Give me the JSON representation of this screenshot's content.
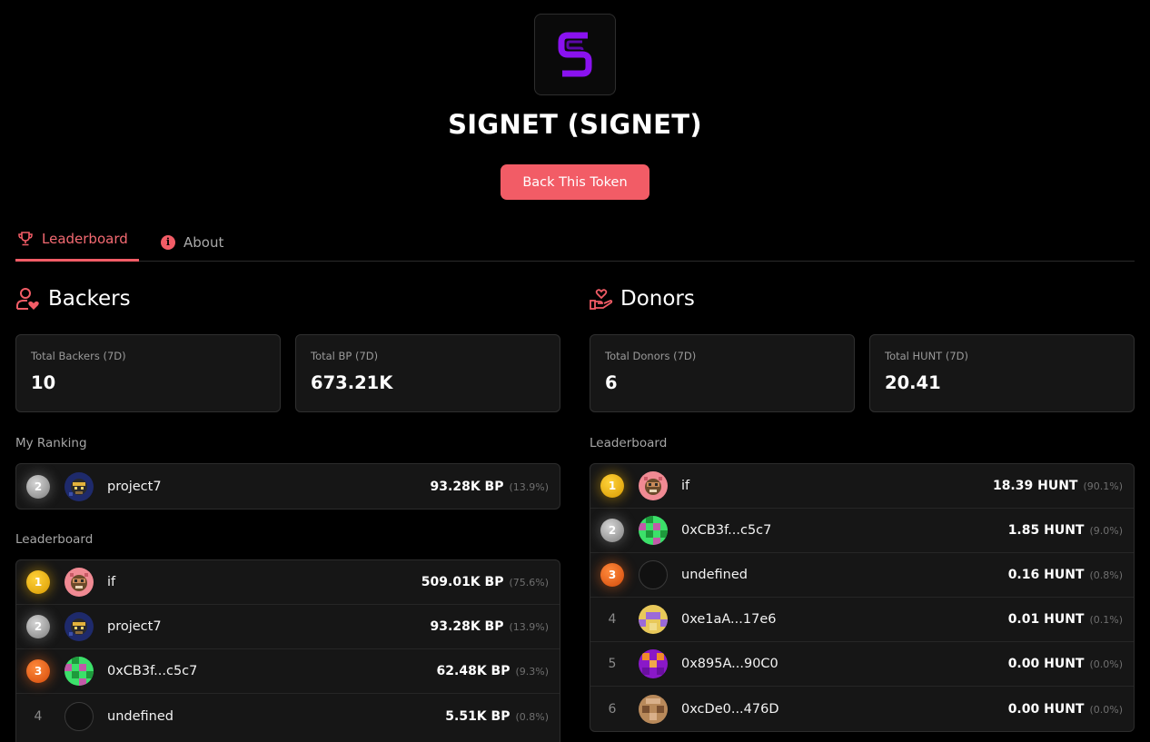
{
  "token": {
    "title": "SIGNET (SIGNET)",
    "back_label": "Back This Token"
  },
  "tabs": [
    {
      "label": "Leaderboard",
      "icon": "trophy-icon",
      "active": true
    },
    {
      "label": "About",
      "icon": "info-icon",
      "active": false
    }
  ],
  "colors": {
    "accent": "#f25c66",
    "logo": "#8a12f0"
  },
  "backers": {
    "heading": "Backers",
    "stats": [
      {
        "label": "Total Backers (7D)",
        "value": "10"
      },
      {
        "label": "Total BP (7D)",
        "value": "673.21K"
      }
    ],
    "my_ranking_label": "My Ranking",
    "my_ranking": {
      "rank": "2",
      "medal": "silver",
      "name": "project7",
      "value": "93.28K BP",
      "pct": "(13.9%)",
      "avatar": "project7"
    },
    "leaderboard_label": "Leaderboard",
    "rows": [
      {
        "rank": "1",
        "medal": "gold",
        "name": "if",
        "value": "509.01K BP",
        "pct": "(75.6%)",
        "avatar": "if"
      },
      {
        "rank": "2",
        "medal": "silver",
        "name": "project7",
        "value": "93.28K BP",
        "pct": "(13.9%)",
        "avatar": "project7"
      },
      {
        "rank": "3",
        "medal": "bronze",
        "name": "0xCB3f...c5c7",
        "value": "62.48K BP",
        "pct": "(9.3%)",
        "avatar": "green"
      },
      {
        "rank": "4",
        "medal": "plain",
        "name": "undefined",
        "value": "5.51K BP",
        "pct": "(0.8%)",
        "avatar": "empty"
      }
    ]
  },
  "donors": {
    "heading": "Donors",
    "stats": [
      {
        "label": "Total Donors (7D)",
        "value": "6"
      },
      {
        "label": "Total HUNT (7D)",
        "value": "20.41"
      }
    ],
    "leaderboard_label": "Leaderboard",
    "rows": [
      {
        "rank": "1",
        "medal": "gold",
        "name": "if",
        "value": "18.39 HUNT",
        "pct": "(90.1%)",
        "avatar": "if"
      },
      {
        "rank": "2",
        "medal": "silver",
        "name": "0xCB3f...c5c7",
        "value": "1.85 HUNT",
        "pct": "(9.0%)",
        "avatar": "green"
      },
      {
        "rank": "3",
        "medal": "bronze",
        "name": "undefined",
        "value": "0.16 HUNT",
        "pct": "(0.8%)",
        "avatar": "empty"
      },
      {
        "rank": "4",
        "medal": "plain",
        "name": "0xe1aA...17e6",
        "value": "0.01 HUNT",
        "pct": "(0.1%)",
        "avatar": "yellow"
      },
      {
        "rank": "5",
        "medal": "plain",
        "name": "0x895A...90C0",
        "value": "0.00 HUNT",
        "pct": "(0.0%)",
        "avatar": "purple"
      },
      {
        "rank": "6",
        "medal": "plain",
        "name": "0xcDe0...476D",
        "value": "0.00 HUNT",
        "pct": "(0.0%)",
        "avatar": "brown"
      }
    ]
  }
}
